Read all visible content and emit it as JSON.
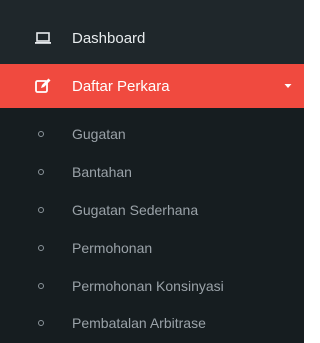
{
  "sidebar": {
    "dashboard": {
      "label": "Dashboard",
      "icon": "laptop-icon"
    },
    "daftar_perkara": {
      "label": "Daftar Perkara",
      "icon": "edit-icon",
      "accent_color": "#f04a3f",
      "expanded": true
    },
    "submenu": [
      {
        "label": "Gugatan"
      },
      {
        "label": "Bantahan"
      },
      {
        "label": "Gugatan Sederhana"
      },
      {
        "label": "Permohonan"
      },
      {
        "label": "Permohonan Konsinyasi"
      },
      {
        "label": "Pembatalan Arbitrase"
      }
    ]
  }
}
